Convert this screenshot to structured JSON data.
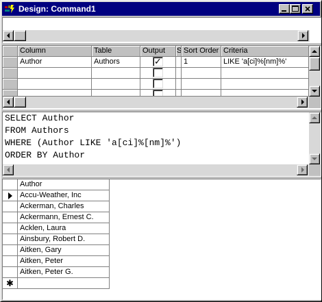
{
  "window": {
    "title": "Design: Command1",
    "icon": "designer-app-icon"
  },
  "grid": {
    "columns": [
      "Column",
      "Table",
      "Output",
      "S",
      "Sort Order",
      "Criteria"
    ],
    "rows": [
      {
        "column": "Author",
        "table": "Authors",
        "output": "✓",
        "sort_order": "1",
        "criteria": "LIKE 'a[ci]%[nm]%'"
      }
    ]
  },
  "sql": {
    "lines": [
      "SELECT Author",
      "FROM Authors",
      "WHERE (Author LIKE 'a[ci]%[nm]%')",
      "ORDER BY Author"
    ]
  },
  "results": {
    "header": "Author",
    "rows": [
      "Accu-Weather, Inc",
      "Ackerman, Charles",
      "Ackermann, Ernest C.",
      "Acklen, Laura",
      "Ainsbury, Robert D.",
      "Aitken, Gary",
      "Aitken, Peter",
      "Aitken, Peter G."
    ],
    "new_row_marker": "✱"
  }
}
